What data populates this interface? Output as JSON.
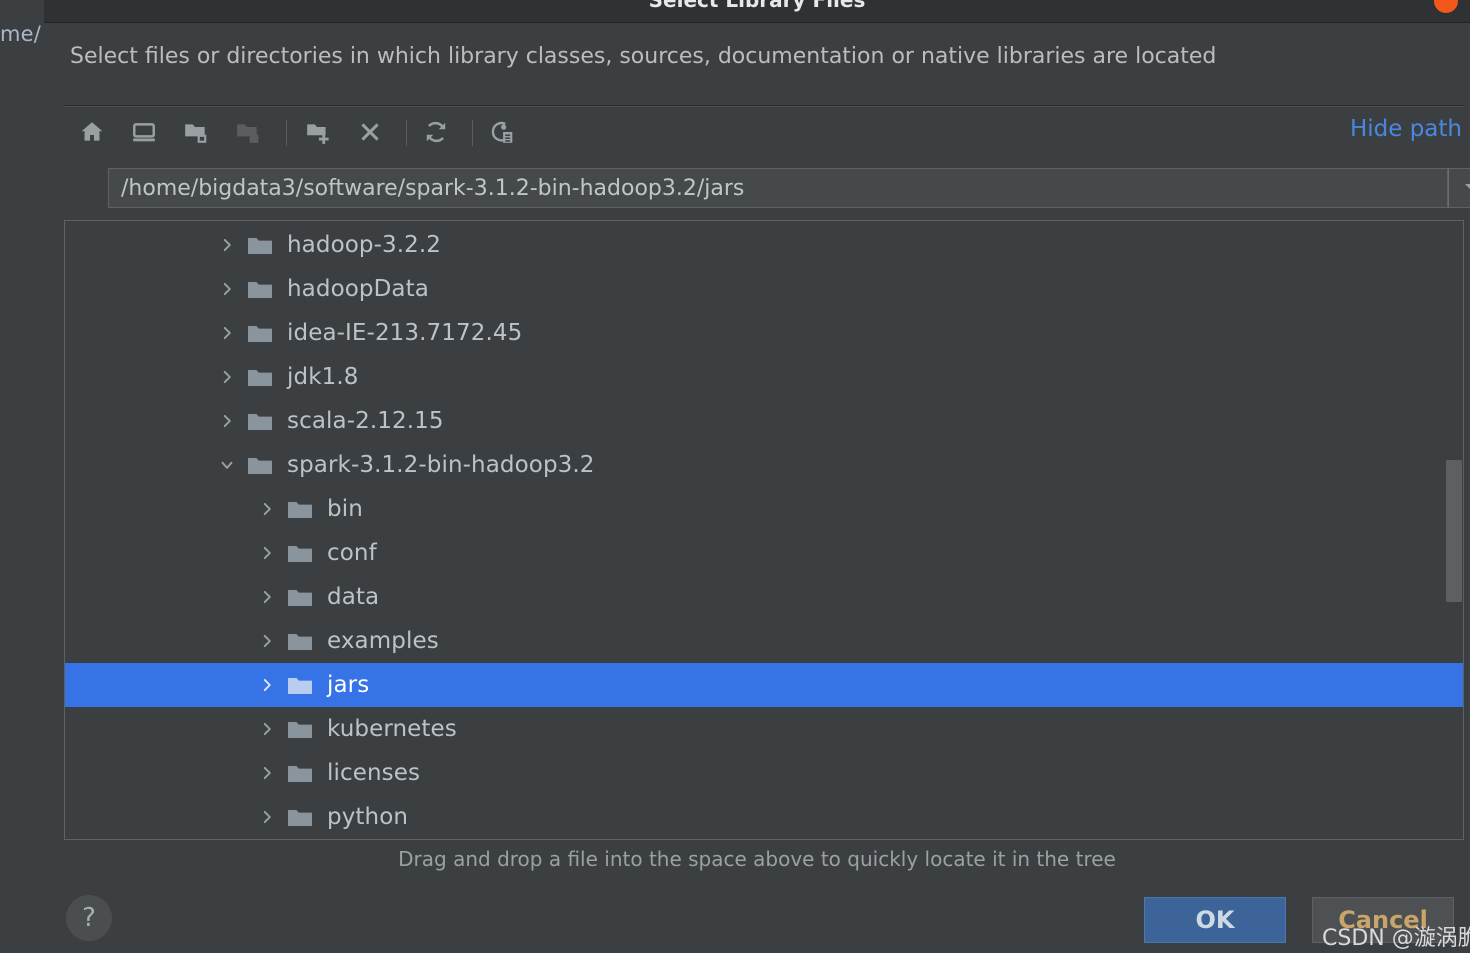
{
  "background_window": {
    "edge_text": "me/"
  },
  "dialog": {
    "title": "Select Library Files",
    "close_icon": "close-circle-icon",
    "description": "Select files or directories in which library classes, sources, documentation or native libraries are located",
    "hide_path_label": "Hide path",
    "hint": "Drag and drop a file into the space above to quickly locate it in the tree"
  },
  "toolbar": {
    "buttons": [
      {
        "name": "home",
        "icon": "home-icon",
        "tooltip": "Home",
        "enabled": true
      },
      {
        "name": "desktop",
        "icon": "desktop-icon",
        "tooltip": "Desktop",
        "enabled": true
      },
      {
        "name": "expand-all",
        "icon": "folder-expand-icon",
        "tooltip": "Expand All",
        "enabled": true
      },
      {
        "name": "collapse-all",
        "icon": "folder-collapse-icon",
        "tooltip": "Collapse All",
        "enabled": false
      },
      {
        "name": "new-folder",
        "icon": "folder-add-icon",
        "tooltip": "New Folder",
        "enabled": true
      },
      {
        "name": "delete",
        "icon": "close-x-icon",
        "tooltip": "Delete",
        "enabled": true
      },
      {
        "name": "refresh",
        "icon": "refresh-icon",
        "tooltip": "Refresh",
        "enabled": true
      },
      {
        "name": "show-hidden",
        "icon": "show-hidden-files-icon",
        "tooltip": "Show Hidden Files",
        "enabled": true
      }
    ]
  },
  "path": {
    "value": "/home/bigdata3/software/spark-3.1.2-bin-hadoop3.2/jars",
    "dropdown_icon": "chevron-down-icon"
  },
  "tree": {
    "nodes": [
      {
        "label": "hadoop-3.2.2",
        "depth": 1,
        "expanded": false,
        "selected": false
      },
      {
        "label": "hadoopData",
        "depth": 1,
        "expanded": false,
        "selected": false
      },
      {
        "label": "idea-IE-213.7172.45",
        "depth": 1,
        "expanded": false,
        "selected": false
      },
      {
        "label": "jdk1.8",
        "depth": 1,
        "expanded": false,
        "selected": false
      },
      {
        "label": "scala-2.12.15",
        "depth": 1,
        "expanded": false,
        "selected": false
      },
      {
        "label": "spark-3.1.2-bin-hadoop3.2",
        "depth": 1,
        "expanded": true,
        "selected": false
      },
      {
        "label": "bin",
        "depth": 2,
        "expanded": false,
        "selected": false
      },
      {
        "label": "conf",
        "depth": 2,
        "expanded": false,
        "selected": false
      },
      {
        "label": "data",
        "depth": 2,
        "expanded": false,
        "selected": false
      },
      {
        "label": "examples",
        "depth": 2,
        "expanded": false,
        "selected": false
      },
      {
        "label": "jars",
        "depth": 2,
        "expanded": false,
        "selected": true
      },
      {
        "label": "kubernetes",
        "depth": 2,
        "expanded": false,
        "selected": false
      },
      {
        "label": "licenses",
        "depth": 2,
        "expanded": false,
        "selected": false
      },
      {
        "label": "python",
        "depth": 2,
        "expanded": false,
        "selected": false
      }
    ],
    "selection_color": "#3573e6"
  },
  "footer": {
    "help_label": "?",
    "ok_label": "OK",
    "cancel_label": "Cancel"
  },
  "watermark": "CSDN @漩涡脆波波",
  "colors": {
    "window_bg": "#3c3f41",
    "titlebar_bg": "#2f3133",
    "accent_link": "#4a87e0",
    "selection": "#3573e6",
    "ok_button": "#3c6498",
    "close_button": "#f2581a",
    "text": "#bcc2c6"
  }
}
